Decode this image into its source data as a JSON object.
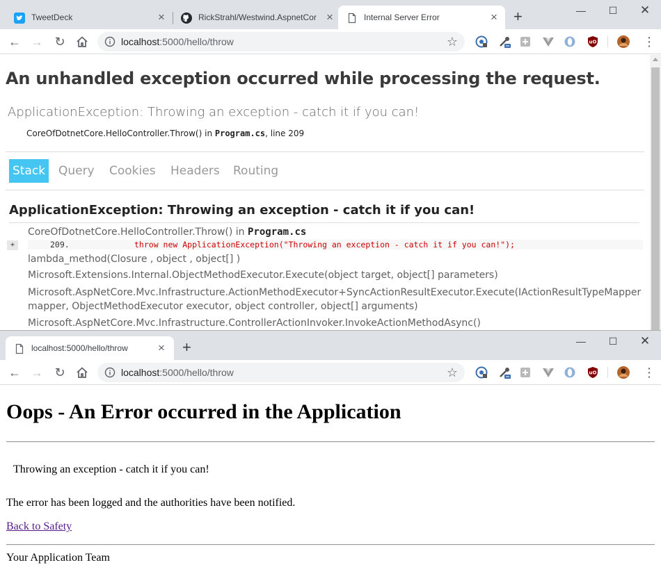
{
  "window1": {
    "tabs": [
      {
        "title": "TweetDeck",
        "icon": "twitter-icon"
      },
      {
        "title": "RickStrahl/Westwind.AspnetCore",
        "icon": "github-icon"
      },
      {
        "title": "Internal Server Error",
        "icon": "page-icon",
        "active": true
      }
    ],
    "address": {
      "host": "localhost",
      "path": ":5000/hello/throw"
    },
    "page": {
      "heading": "An unhandled exception occurred while processing the request.",
      "exception": "ApplicationException: Throwing an exception - catch it if you can!",
      "location_method": "CoreOfDotnetCore.HelloController.Throw() in ",
      "location_file": "Program.cs",
      "location_line": ", line 209",
      "tabs": [
        "Stack",
        "Query",
        "Cookies",
        "Headers",
        "Routing"
      ],
      "selected_tab": "Stack",
      "stack_heading": "ApplicationException: Throwing an exception - catch it if you can!",
      "frame0_method": "CoreOfDotnetCore.HelloController.Throw() in ",
      "frame0_file": "Program.cs",
      "expand_label": "+",
      "code_line_number": "209.",
      "code_line": "throw new ApplicationException(\"Throwing an exception - catch it if you can!\");",
      "frames": [
        "lambda_method(Closure , object , object[] )",
        "Microsoft.Extensions.Internal.ObjectMethodExecutor.Execute(object target, object[] parameters)",
        "Microsoft.AspNetCore.Mvc.Infrastructure.ActionMethodExecutor+SyncActionResultExecutor.Execute(IActionResultTypeMapper",
        "mapper, ObjectMethodExecutor executor, object controller, object[] arguments)",
        "Microsoft.AspNetCore.Mvc.Infrastructure.ControllerActionInvoker.InvokeActionMethodAsync()"
      ]
    }
  },
  "window2": {
    "tabs": [
      {
        "title": "localhost:5000/hello/throw",
        "icon": "page-icon",
        "active": true
      }
    ],
    "address": {
      "host": "localhost",
      "path": ":5000/hello/throw"
    },
    "page": {
      "heading": "Oops - An Error occurred in the Application",
      "message": "Throwing an exception - catch it if you can!",
      "logged": "The error has been logged and the authorities have been notified.",
      "back_link": "Back to Safety",
      "signature": "Your Application Team"
    }
  },
  "colors": {
    "tab_strip": "#dee1e6",
    "selected_tab": "#44c5f2",
    "code_text": "#cc0000",
    "link": "#551a8b"
  }
}
